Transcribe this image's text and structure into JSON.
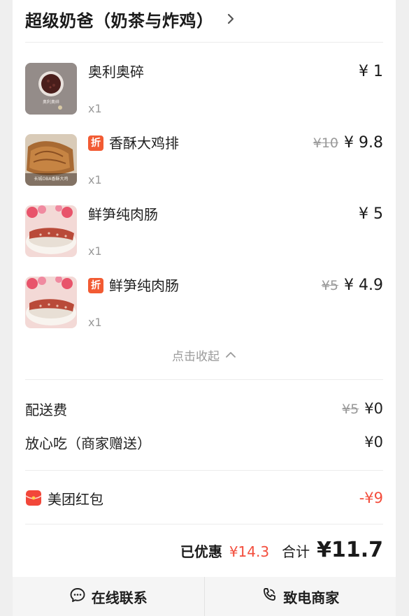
{
  "shop": {
    "name": "超级奶爸（奶茶与炸鸡）"
  },
  "items": [
    {
      "name": "奥利奥碎",
      "qty": "x1",
      "price": "¥ 1",
      "original_price": "",
      "discount_tag": "",
      "thumb_text": "奥利奥碎"
    },
    {
      "name": "香酥大鸡排",
      "qty": "x1",
      "price": "¥ 9.8",
      "original_price": "¥10",
      "discount_tag": "折",
      "thumb_text": "长城OBA香酥大鸡"
    },
    {
      "name": "鲜笋纯肉肠",
      "qty": "x1",
      "price": "¥ 5",
      "original_price": "",
      "discount_tag": ""
    },
    {
      "name": "鲜笋纯肉肠",
      "qty": "x1",
      "price": "¥ 4.9",
      "original_price": "¥5",
      "discount_tag": "折"
    }
  ],
  "collapse": {
    "label": "点击收起"
  },
  "fees": {
    "delivery_label": "配送费",
    "delivery_original": "¥5",
    "delivery_value": "¥0",
    "assurance_label": "放心吃（商家赠送）",
    "assurance_value": "¥0"
  },
  "redpacket": {
    "label": "美团红包",
    "value": "-¥9"
  },
  "summary": {
    "saved_label": "已优惠",
    "saved_value": "¥14.3",
    "total_label": "合计",
    "total_value": "¥11.7"
  },
  "bottom": {
    "chat_label": "在线联系",
    "call_label": "致电商家"
  },
  "colors": {
    "accent_red": "#f34d3c",
    "discount_tag": "#f25b33",
    "muted": "#9a9a9a"
  },
  "icons": {
    "shop_chevron": "chevron-right-icon",
    "collapse": "chevron-up-icon",
    "redpacket": "red-packet-icon",
    "chat": "chat-bubble-icon",
    "call": "phone-icon"
  }
}
